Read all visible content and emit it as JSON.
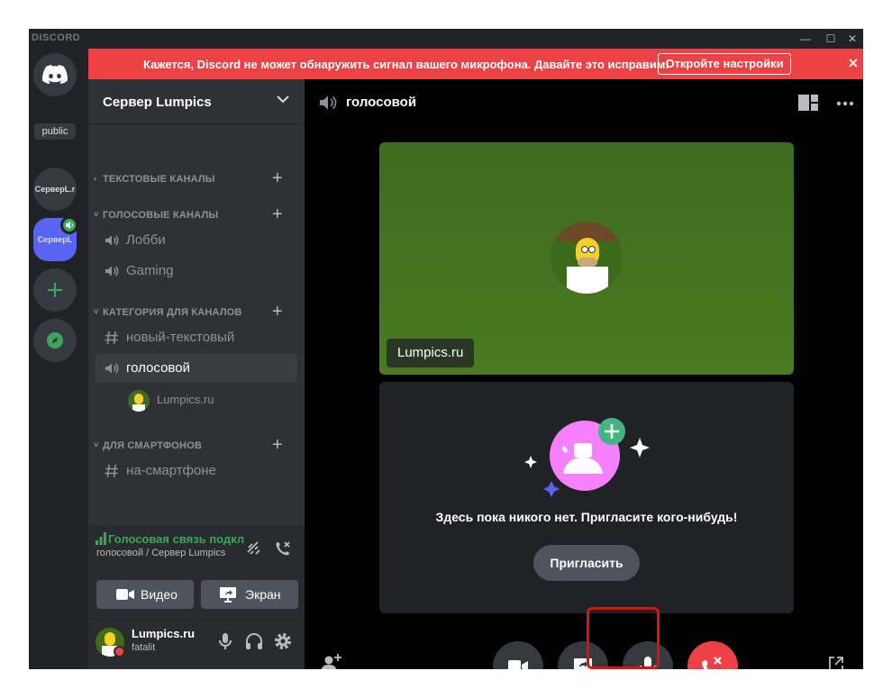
{
  "app": {
    "brand": "DISCORD"
  },
  "window_controls": {
    "minimize": "—",
    "maximize": "☐",
    "close": "✕"
  },
  "rail": {
    "public_label": "public",
    "server1": "СерверL.r",
    "server2": "СерверL"
  },
  "banner": {
    "text": "Кажется, Discord не может обнаружить сигнал вашего микрофона. Давайте это исправим!",
    "button": "Откройте настройки",
    "close": "✕",
    "color": "#ed4245"
  },
  "sidebar": {
    "server_name": "Сервер Lumpics",
    "categories": [
      {
        "label": "ТЕКСТОВЫЕ КАНАЛЫ"
      },
      {
        "label": "ГОЛОСОВЫЕ КАНАЛЫ"
      },
      {
        "label": "КАТЕГОРИЯ ДЛЯ КАНАЛОВ"
      },
      {
        "label": "ДЛЯ СМАРТФОНОВ"
      }
    ],
    "channels": {
      "lobby": "Лобби",
      "gaming": "Gaming",
      "new_text": "новый-текстовый",
      "voice": "голосовой",
      "voice_user": "Lumpics.ru",
      "smartphone": "на-смартфоне"
    }
  },
  "voice_panel": {
    "status": "Голосовая связь подключена",
    "location": "голосовой / Сервер Lumpics",
    "video_button": "Видео",
    "screen_button": "Экран"
  },
  "user_panel": {
    "name": "Lumpics.ru",
    "tag": "fatalit"
  },
  "main": {
    "channel_title": "голосовой",
    "tile_user_label": "Lumpics.ru",
    "empty_text": "Здесь пока никого нет. Пригласите кого-нибудь!",
    "invite_button": "Пригласить"
  },
  "icons": [
    "discord-logo-icon",
    "compass-icon",
    "speaker-icon",
    "hash-icon",
    "camera-icon",
    "screen-share-icon",
    "microphone-icon",
    "headphones-icon",
    "gear-icon",
    "hangup-icon",
    "add-user-icon",
    "popout-icon",
    "fullscreen-icon",
    "grid-icon",
    "more-icon",
    "signal-icon",
    "noise-suppression-icon",
    "disconnect-icon"
  ],
  "colors": {
    "accent": "#5865f2",
    "green": "#3ba55d",
    "danger": "#ed4245",
    "highlight": "#e01010"
  }
}
